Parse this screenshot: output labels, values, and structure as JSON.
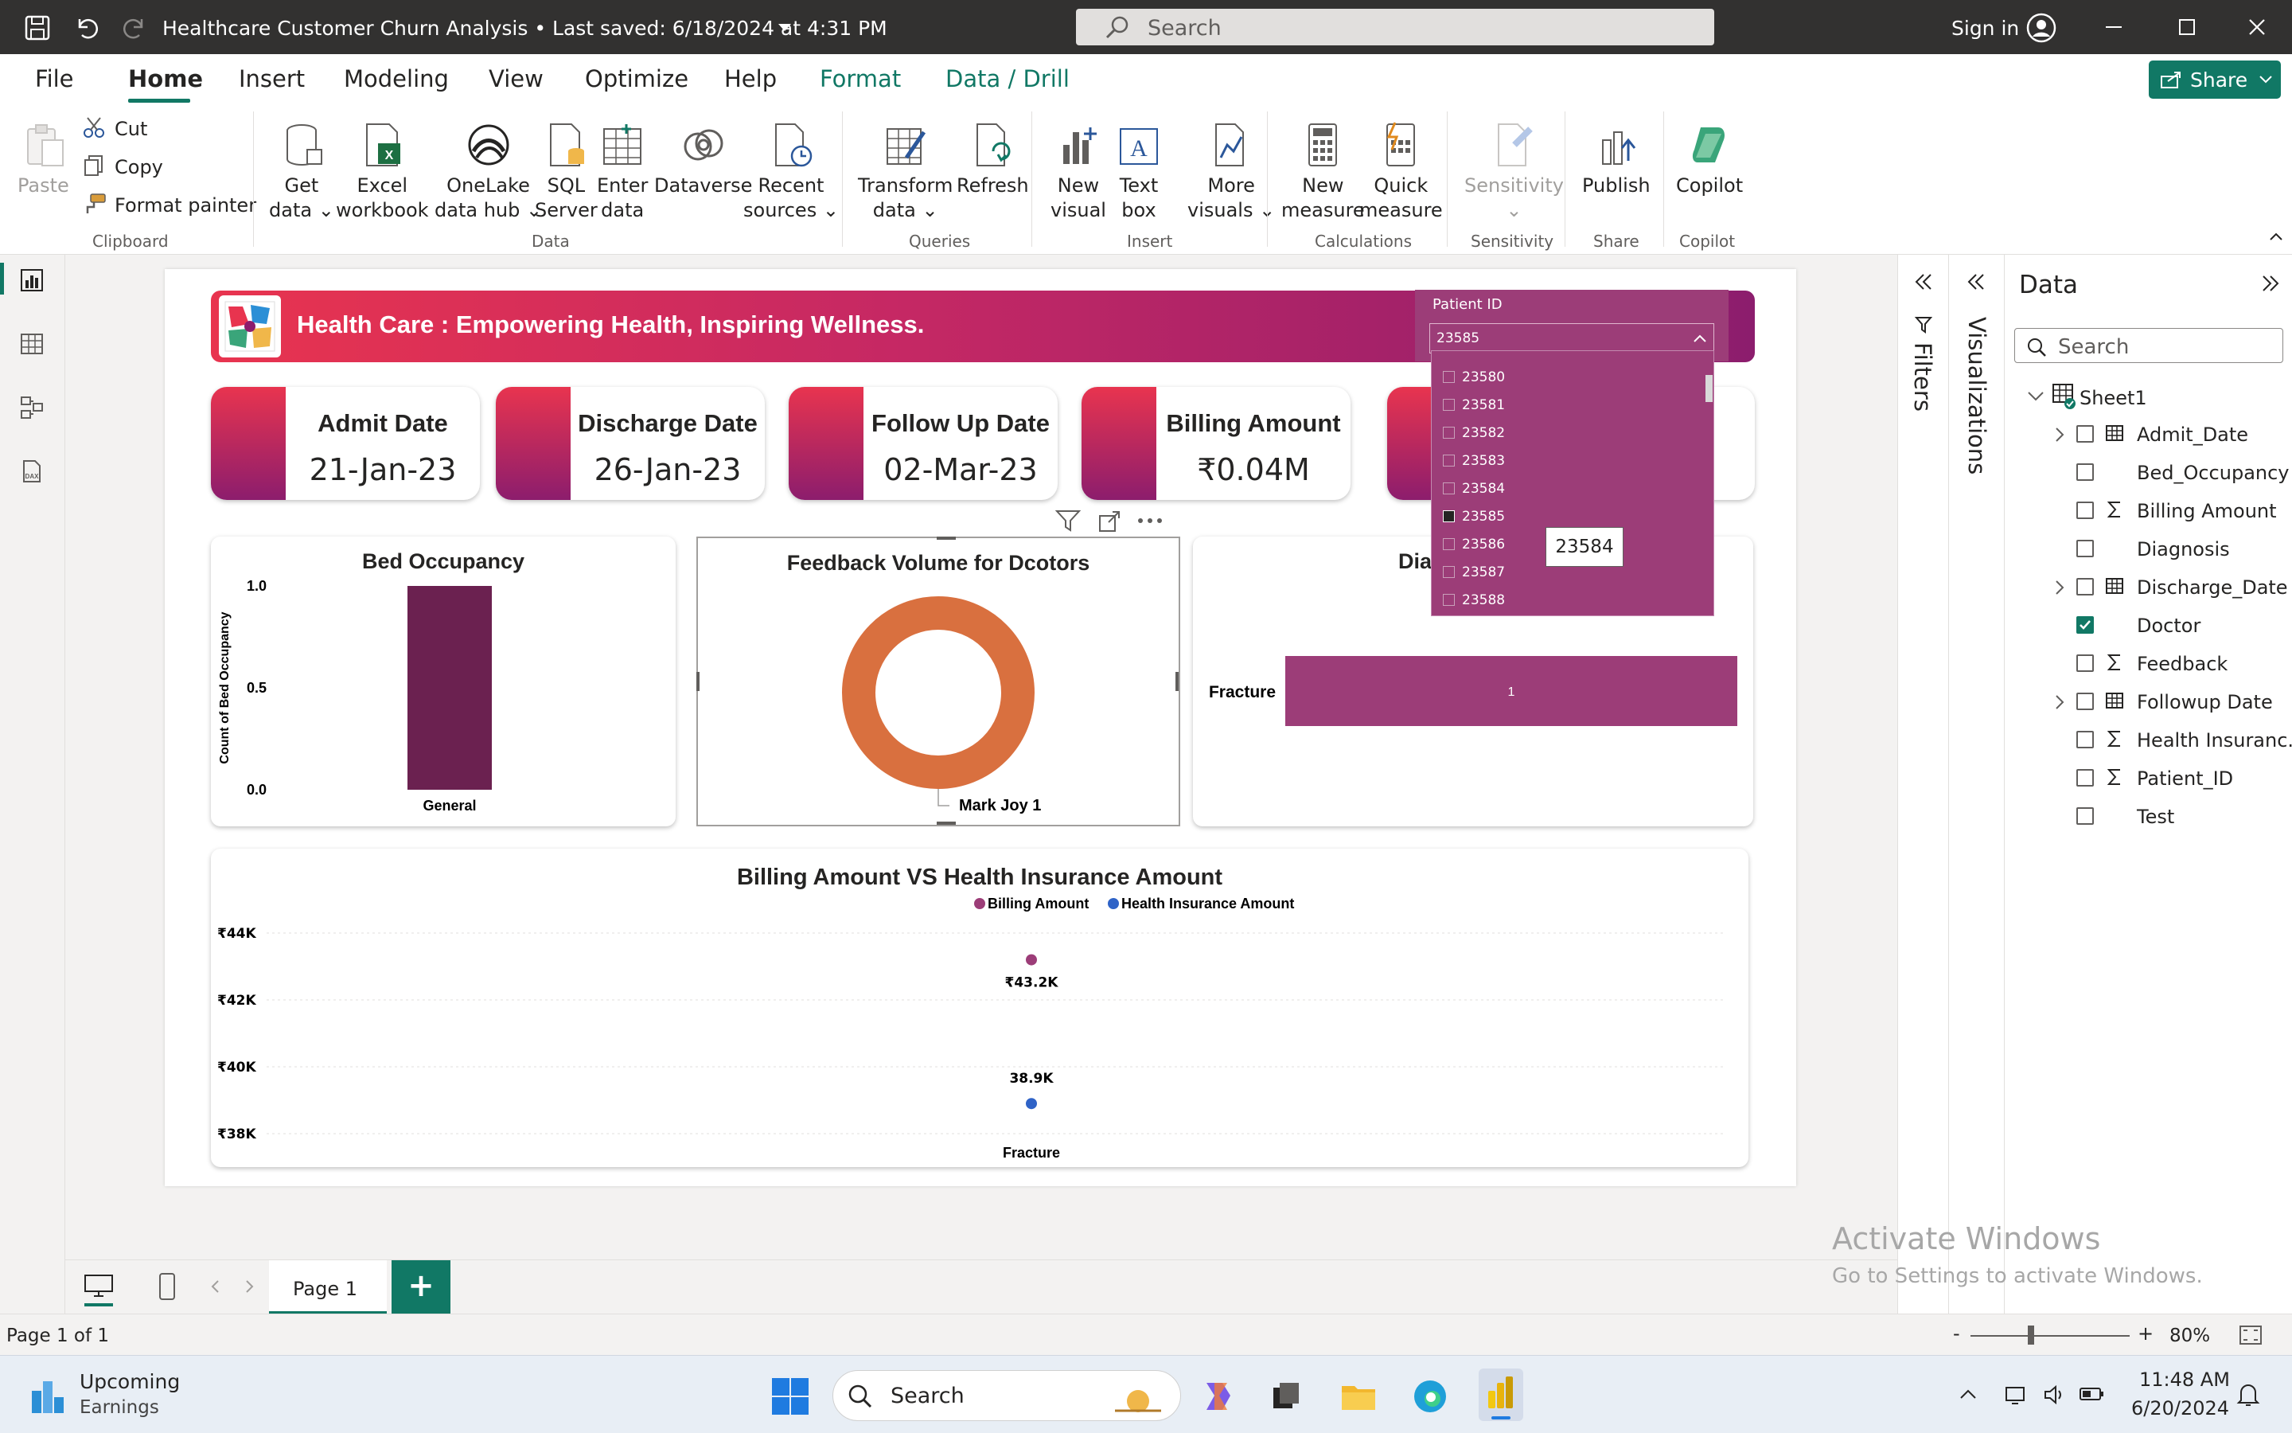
{
  "titlebar": {
    "title": "Healthcare Customer Churn Analysis • Last saved: 6/18/2024 at 4:31 PM",
    "search_placeholder": "Search",
    "signin": "Sign in"
  },
  "menu": {
    "file": "File",
    "home": "Home",
    "insert": "Insert",
    "modeling": "Modeling",
    "view": "View",
    "optimize": "Optimize",
    "help": "Help",
    "format": "Format",
    "data_drill": "Data / Drill",
    "share": "Share"
  },
  "ribbon": {
    "paste": "Paste",
    "cut": "Cut",
    "copy": "Copy",
    "format_painter": "Format painter",
    "get_data": [
      "Get",
      "data"
    ],
    "excel": [
      "Excel",
      "workbook"
    ],
    "onelake": [
      "OneLake",
      "data hub"
    ],
    "sql": [
      "SQL",
      "Server"
    ],
    "enter_data": [
      "Enter",
      "data"
    ],
    "dataverse": "Dataverse",
    "recent": [
      "Recent",
      "sources"
    ],
    "transform": [
      "Transform",
      "data"
    ],
    "refresh": "Refresh",
    "new_visual": [
      "New",
      "visual"
    ],
    "text_box": [
      "Text",
      "box"
    ],
    "more_visuals": [
      "More",
      "visuals"
    ],
    "new_measure": [
      "New",
      "measure"
    ],
    "quick_measure": [
      "Quick",
      "measure"
    ],
    "sensitivity": "Sensitivity",
    "publish": "Publish",
    "copilot": "Copilot",
    "groups": {
      "clipboard": "Clipboard",
      "data": "Data",
      "queries": "Queries",
      "insert": "Insert",
      "calculations": "Calculations",
      "sensitivity": "Sensitivity",
      "share": "Share",
      "copilot": "Copilot"
    }
  },
  "report": {
    "banner_title": "Health Care : Empowering Health, Inspiring Wellness.",
    "slicer": {
      "label": "Patient ID",
      "selected": "23585",
      "items": [
        "23580",
        "23581",
        "23582",
        "23583",
        "23584",
        "23585",
        "23586",
        "23587",
        "23588"
      ],
      "checked": "23585",
      "tooltip": "23584"
    },
    "kpis": [
      {
        "label": "Admit Date",
        "value": "21-Jan-23"
      },
      {
        "label": "Discharge Date",
        "value": "26-Jan-23"
      },
      {
        "label": "Follow Up Date",
        "value": "02-Mar-23"
      },
      {
        "label": "Billing Amount",
        "value": "₹0.04M"
      }
    ],
    "diagnosis_title_partial": "Dia"
  },
  "chart_data": [
    {
      "type": "bar",
      "title": "Bed Occupancy",
      "ylabel": "Count of Bed Occupancy",
      "categories": [
        "General"
      ],
      "values": [
        1
      ],
      "ylim": [
        0,
        1
      ],
      "yticks": [
        "0.0",
        "0.5",
        "1.0"
      ],
      "color": "#6b2150"
    },
    {
      "type": "pie",
      "title": "Feedback Volume for Dcotors",
      "labels": [
        "Mark Joy 1"
      ],
      "values": [
        1
      ],
      "donut": true,
      "color": "#d9703f"
    },
    {
      "type": "bar",
      "orientation": "horizontal",
      "categories": [
        "Fracture"
      ],
      "values": [
        1
      ],
      "data_labels": [
        "1"
      ],
      "color": "#9c3d78"
    },
    {
      "type": "scatter",
      "title": "Billing Amount VS Health Insurance Amount",
      "categories": [
        "Fracture"
      ],
      "yticks": [
        "₹38K",
        "₹40K",
        "₹42K",
        "₹44K"
      ],
      "ylim": [
        38000,
        44000
      ],
      "legend_position": "top-center",
      "series": [
        {
          "name": "Billing Amount",
          "values": [
            43200
          ],
          "label": "₹43.2K",
          "color": "#9c3d78"
        },
        {
          "name": "Health Insurance Amount",
          "values": [
            38900
          ],
          "label": "38.9K",
          "color": "#2f63c7"
        }
      ]
    }
  ],
  "panes": {
    "filters": "Filters",
    "visualizations": "Visualizations",
    "data_title": "Data",
    "search_placeholder": "Search",
    "table": "Sheet1",
    "fields": [
      {
        "name": "Admit_Date",
        "icon": "calendar",
        "expand": true,
        "checked": false
      },
      {
        "name": "Bed_Occupancy",
        "icon": "",
        "expand": false,
        "checked": false
      },
      {
        "name": "Billing Amount",
        "icon": "sigma",
        "expand": false,
        "checked": false
      },
      {
        "name": "Diagnosis",
        "icon": "",
        "expand": false,
        "checked": false
      },
      {
        "name": "Discharge_Date",
        "icon": "calendar",
        "expand": true,
        "checked": false
      },
      {
        "name": "Doctor",
        "icon": "",
        "expand": false,
        "checked": true
      },
      {
        "name": "Feedback",
        "icon": "sigma",
        "expand": false,
        "checked": false
      },
      {
        "name": "Followup Date",
        "icon": "calendar",
        "expand": true,
        "checked": false
      },
      {
        "name": "Health Insuranc...",
        "icon": "sigma",
        "expand": false,
        "checked": false
      },
      {
        "name": "Patient_ID",
        "icon": "sigma",
        "expand": false,
        "checked": false
      },
      {
        "name": "Test",
        "icon": "",
        "expand": false,
        "checked": false
      }
    ]
  },
  "pages": {
    "tab": "Page 1",
    "add": "+"
  },
  "status": {
    "page": "Page 1 of 1",
    "zoom": "80%",
    "zoom_minus": "-",
    "zoom_plus": "+"
  },
  "watermark": {
    "line1": "Activate Windows",
    "line2": "Go to Settings to activate Windows."
  },
  "taskbar": {
    "widget_title": "Upcoming",
    "widget_sub": "Earnings",
    "search": "Search",
    "time": "11:48 AM",
    "date": "6/20/2024"
  }
}
